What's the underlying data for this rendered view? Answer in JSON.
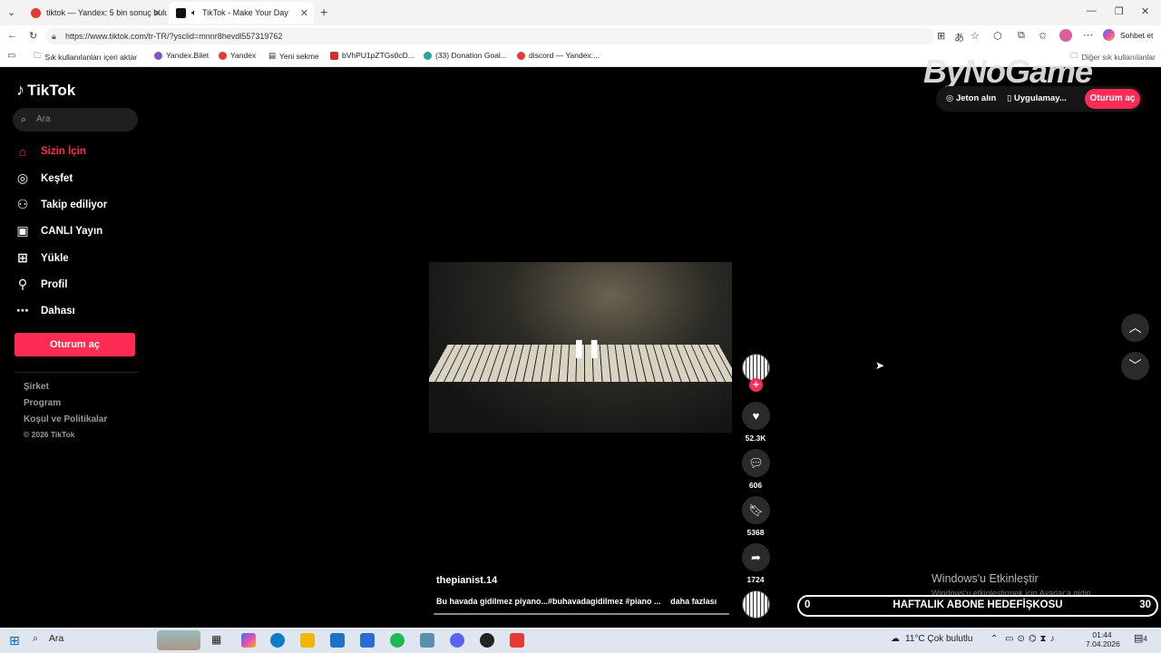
{
  "browser": {
    "tabs": [
      {
        "title": "tiktok — Yandex: 5 bin sonuç bulu"
      },
      {
        "title": "TikTok - Make Your Day"
      }
    ],
    "url": "https://www.tiktok.com/tr-TR/?ysclid=mnnr8hevdl557319762",
    "chat_button": "Sohbet et",
    "bookmarks": [
      "Sık kullanılanları içeri aktar",
      "Yandex.Bilet",
      "Yandex",
      "Yeni sekme",
      "bVhPU1pZTGs0cD...",
      "(33) Donation Goal...",
      "discord — Yandex:...",
      "Diğer sık kullanılanlar"
    ]
  },
  "sidebar": {
    "logo": "TikTok",
    "search_placeholder": "Ara",
    "nav": [
      {
        "label": "Sizin İçin"
      },
      {
        "label": "Keşfet"
      },
      {
        "label": "Takip ediliyor"
      },
      {
        "label": "CANLI Yayın"
      },
      {
        "label": "Yükle"
      },
      {
        "label": "Profil"
      },
      {
        "label": "Dahası"
      }
    ],
    "login": "Oturum aç",
    "footer": [
      "Şirket",
      "Program",
      "Koşul ve Politikalar",
      "© 2026 TikTok"
    ]
  },
  "video": {
    "author": "thepianist.14",
    "caption": "Bu havada gidilmez piyano...#buhavadagidilmez #piano ...",
    "more": "daha fazlası",
    "likes": "52.3K",
    "comments": "606",
    "saves": "5368",
    "shares": "1724"
  },
  "header": {
    "coins": "Jeton alın",
    "app": "Uygulamay...",
    "login": "Oturum aç"
  },
  "overlay": {
    "watermark": "ByNoGame",
    "activate_title": "Windows'u Etkinleştir",
    "activate_sub": "Windows'u etkinleştirmek için Ayarlar'a gidin",
    "goal_left": "0",
    "goal_title": "HAFTALIK ABONE HEDEFİŞKOSU",
    "goal_right": "30"
  },
  "taskbar": {
    "search": "Ara",
    "weather": "11°C  Çok bulutlu",
    "time": "01:44",
    "date": "7.04.2026",
    "notifications": "4"
  },
  "colors": {
    "accent": "#fe2c55",
    "bg": "#000000"
  }
}
